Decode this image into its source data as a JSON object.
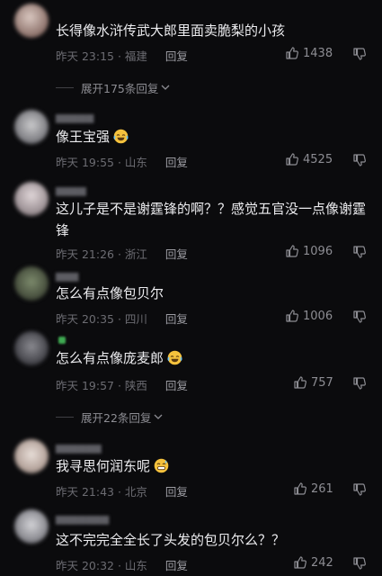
{
  "comments": [
    {
      "text": "长得像水浒传武大郎里面卖脆梨的小孩",
      "time": "昨天 23:15",
      "location": "福建",
      "reply": "回复",
      "likes": "1438",
      "emoji": ""
    },
    {
      "text": "像王宝强",
      "time": "昨天 19:55",
      "location": "山东",
      "reply": "回复",
      "likes": "4525",
      "emoji": "laughing-tears"
    },
    {
      "text": "这儿子是不是谢霆锋的啊？？感觉五官没一点像谢霆锋",
      "time": "昨天 21:26",
      "location": "浙江",
      "reply": "回复",
      "likes": "1096",
      "emoji": ""
    },
    {
      "text": "怎么有点像包贝尔",
      "time": "昨天 20:35",
      "location": "四川",
      "reply": "回复",
      "likes": "1006",
      "emoji": ""
    },
    {
      "text": "怎么有点像庞麦郎",
      "time": "昨天 19:57",
      "location": "陕西",
      "reply": "回复",
      "likes": "757",
      "emoji": "laughing-tears"
    },
    {
      "text": "我寻思何润东呢",
      "time": "昨天 21:43",
      "location": "北京",
      "reply": "回复",
      "likes": "261",
      "emoji": "grinning-sweat"
    },
    {
      "text": "这不完完全全长了头发的包贝尔么？？",
      "time": "昨天 20:32",
      "location": "山东",
      "reply": "回复",
      "likes": "242",
      "emoji": ""
    }
  ],
  "expand_1": "展开175条回复",
  "expand_2": "展开22条回复",
  "colors": {
    "background": "#0b0b0d",
    "text": "#ececef",
    "meta": "#6c6c72",
    "emoji": "#f5c23d"
  }
}
